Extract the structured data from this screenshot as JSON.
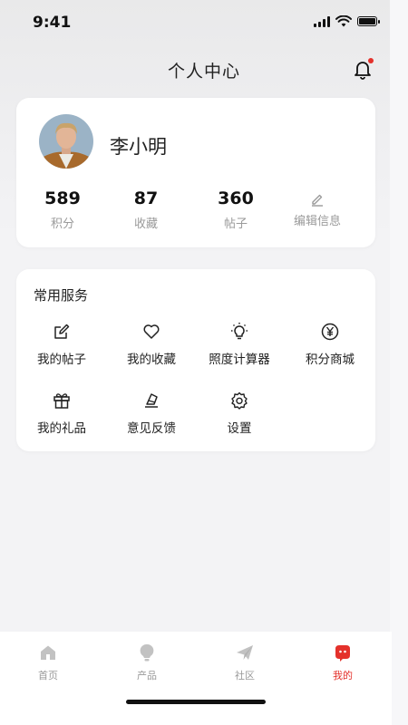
{
  "status_bar": {
    "time": "9:41"
  },
  "header": {
    "title": "个人中心"
  },
  "profile": {
    "name": "李小明",
    "stats": [
      {
        "value": "589",
        "label": "积分"
      },
      {
        "value": "87",
        "label": "收藏"
      },
      {
        "value": "360",
        "label": "帖子"
      }
    ],
    "edit_label": "编辑信息"
  },
  "services": {
    "title": "常用服务",
    "items": [
      {
        "label": "我的帖子",
        "icon": "edit-icon"
      },
      {
        "label": "我的收藏",
        "icon": "heart-icon"
      },
      {
        "label": "照度计算器",
        "icon": "bulb-icon"
      },
      {
        "label": "积分商城",
        "icon": "yen-icon"
      },
      {
        "label": "我的礼品",
        "icon": "gift-icon"
      },
      {
        "label": "意见反馈",
        "icon": "feedback-icon"
      },
      {
        "label": "设置",
        "icon": "settings-icon"
      }
    ]
  },
  "tabbar": {
    "items": [
      {
        "label": "首页",
        "icon": "home-icon"
      },
      {
        "label": "产品",
        "icon": "product-icon"
      },
      {
        "label": "社区",
        "icon": "community-icon"
      },
      {
        "label": "我的",
        "icon": "profile-icon"
      }
    ],
    "active_color": "#e4312b",
    "inactive_color": "#c2c2c2"
  }
}
